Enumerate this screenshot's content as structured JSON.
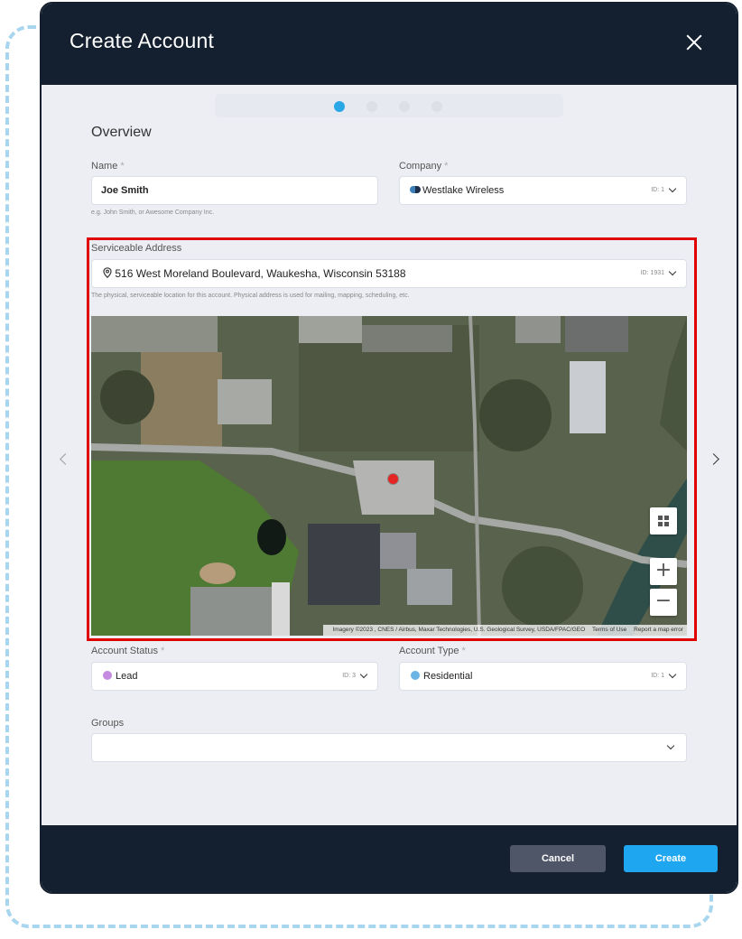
{
  "modal": {
    "title": "Create Account"
  },
  "steps": {
    "count": 4,
    "active_index": 0
  },
  "overview": {
    "section_title": "Overview",
    "name": {
      "label": "Name",
      "required_marker": "*",
      "value": "Joe Smith",
      "hint": "e.g. John Smith, or Awesome Company Inc."
    },
    "company": {
      "label": "Company",
      "required_marker": "*",
      "value": "Westlake Wireless",
      "id_tag": "ID: 1"
    }
  },
  "address": {
    "label": "Serviceable Address",
    "value": "516 West Moreland Boulevard, Waukesha, Wisconsin 53188",
    "id_tag": "ID: 1931",
    "hint": "The physical, serviceable location for this account. Physical address is used for mailing, mapping, scheduling, etc."
  },
  "map": {
    "layer_icon": "layers-grid-icon",
    "zoom_in_label": "+",
    "zoom_out_label": "−",
    "attribution": "Imagery ©2023 , CNES / Airbus, Maxar Technologies, U.S. Geological Survey, USDA/FPAC/GEO",
    "terms_label": "Terms of Use",
    "report_label": "Report a map error"
  },
  "account_status": {
    "label": "Account Status",
    "required_marker": "*",
    "value": "Lead",
    "id_tag": "ID: 3",
    "color": "#c58be0"
  },
  "account_type": {
    "label": "Account Type",
    "required_marker": "*",
    "value": "Residential",
    "id_tag": "ID: 1",
    "color": "#6bb4e6"
  },
  "groups": {
    "label": "Groups",
    "value": ""
  },
  "footer": {
    "cancel_label": "Cancel",
    "create_label": "Create"
  },
  "colors": {
    "header_bg": "#14202f",
    "accent": "#1ea7f0",
    "highlight": "#e00000"
  }
}
